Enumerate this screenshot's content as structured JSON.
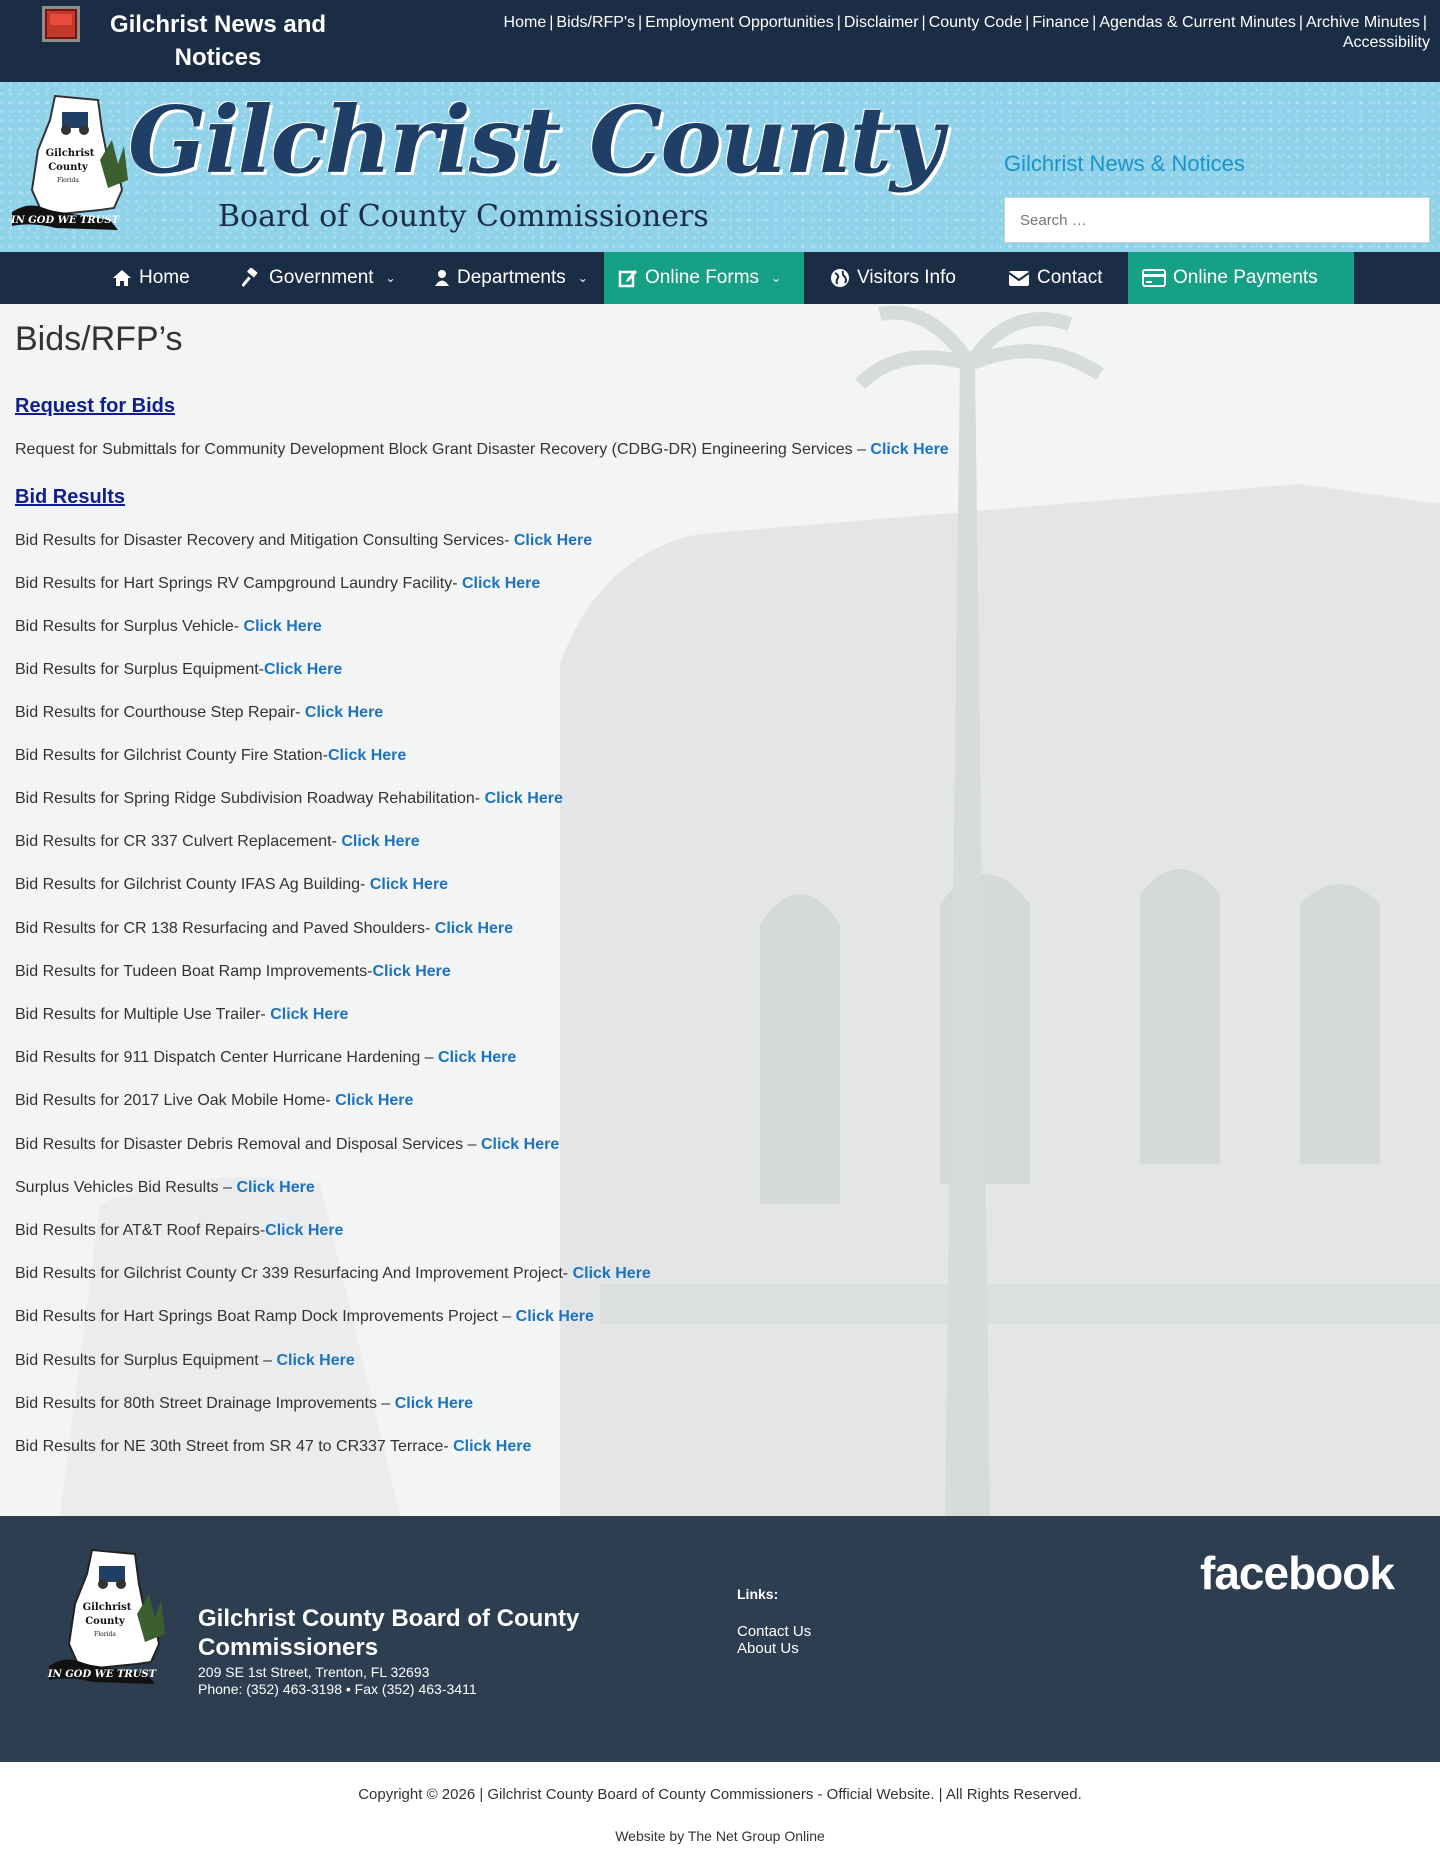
{
  "topbar": {
    "site_title": "Gilchrist News and Notices",
    "links": [
      "Home",
      "Bids/RFP's",
      "Employment Opportunities",
      "Disclaimer",
      "County Code",
      "Finance",
      "Agendas & Current Minutes",
      "Archive Minutes",
      "Accessibility"
    ]
  },
  "banner": {
    "brand_main": "Gilchrist County",
    "brand_sub": "Board of County Commissioners",
    "seal_text": [
      "Gilchrist",
      "County",
      "Florida",
      "IN GOD WE TRUST"
    ],
    "news_heading": "Gilchrist News & Notices",
    "search_placeholder": "Search …"
  },
  "nav": {
    "items": [
      {
        "label": "Home",
        "icon": "home-icon"
      },
      {
        "label": "Government",
        "icon": "gavel-icon"
      },
      {
        "label": "Departments",
        "icon": "user-icon"
      },
      {
        "label": "Online Forms",
        "icon": "edit-icon"
      },
      {
        "label": "Visitors Info",
        "icon": "globe-icon"
      },
      {
        "label": "Contact",
        "icon": "envelope-icon"
      },
      {
        "label": "Online Payments",
        "icon": "credit-card-icon"
      }
    ]
  },
  "main": {
    "page_title": "Bids/RFP’s",
    "rfb_heading": "Request for Bids",
    "rfb_items": [
      {
        "text": "Request for Submittals for Community Development Block Grant Disaster Recovery (CDBG-DR) Engineering Services – ",
        "link": "Click Here"
      }
    ],
    "results_heading": "Bid Results",
    "results": [
      {
        "text": "Bid Results for Disaster Recovery and Mitigation Consulting Services- ",
        "link": "Click Here"
      },
      {
        "text": "Bid Results for Hart Springs RV Campground Laundry Facility- ",
        "link": "Click Here"
      },
      {
        "text": "Bid Results for Surplus Vehicle- ",
        "link": "Click Here"
      },
      {
        "text": "Bid Results for Surplus Equipment-",
        "link": "Click Here"
      },
      {
        "text": "Bid Results for Courthouse Step Repair- ",
        "link": "Click Here"
      },
      {
        "text": "Bid Results for Gilchrist County Fire Station-",
        "link": "Click Here"
      },
      {
        "text": "Bid Results for Spring Ridge Subdivision Roadway Rehabilitation- ",
        "link": "Click Here"
      },
      {
        "text": "Bid Results for CR 337 Culvert Replacement- ",
        "link": "Click Here"
      },
      {
        "text": "Bid Results for Gilchrist County IFAS Ag Building- ",
        "link": "Click Here"
      },
      {
        "text": "Bid Results for CR 138 Resurfacing and Paved Shoulders- ",
        "link": "Click Here"
      },
      {
        "text": "Bid Results for Tudeen Boat Ramp Improvements-",
        "link": "Click Here"
      },
      {
        "text": "Bid Results for Multiple Use Trailer- ",
        "link": "Click Here"
      },
      {
        "text": "Bid Results for 911 Dispatch Center Hurricane Hardening – ",
        "link": "Click Here"
      },
      {
        "text": "Bid Results for 2017 Live Oak Mobile Home- ",
        "link": "Click Here"
      },
      {
        "text": "Bid Results for Disaster Debris Removal and Disposal Services – ",
        "link": "Click Here"
      },
      {
        "text": "Surplus Vehicles Bid Results – ",
        "link": "Click Here"
      },
      {
        "text": "Bid Results for AT&T Roof Repairs-",
        "link": "Click Here"
      },
      {
        "text": "Bid Results for Gilchrist County Cr 339 Resurfacing And Improvement Project- ",
        "link": "Click Here"
      },
      {
        "text": "Bid Results for Hart Springs Boat Ramp Dock Improvements Project – ",
        "link": "Click Here"
      },
      {
        "text": "Bid Results for Surplus Equipment – ",
        "link": "Click Here"
      },
      {
        "text": "Bid Results for 80th Street Drainage Improvements – ",
        "link": "Click Here"
      },
      {
        "text": "Bid Results for NE 30th Street from SR 47 to CR337 Terrace- ",
        "link": "Click Here"
      }
    ]
  },
  "footer": {
    "org_name": "Gilchrist County Board of County Commissioners",
    "address": "209 SE 1st Street, Trenton, FL 32693",
    "phone": "Phone: (352) 463-3198 • Fax (352) 463-3411",
    "links_heading": "Links:",
    "links": [
      "Contact Us",
      "About Us"
    ],
    "facebook": "facebook"
  },
  "bottom": {
    "copyright": "Copyright © 2026 | Gilchrist County Board of County Commissioners - Official Website. | All Rights Reserved.",
    "credit": "Website by The Net Group Online"
  },
  "colors": {
    "topbar": "#1b2d44",
    "banner": "#90d2ea",
    "nav_teal": "#16a085",
    "link": "#1e73be",
    "heading_link": "#0f1e8c",
    "footer": "#2c3e50"
  }
}
